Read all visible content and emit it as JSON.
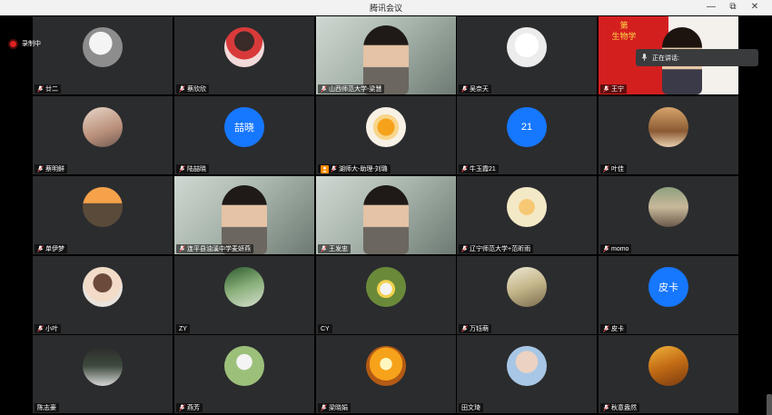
{
  "window": {
    "title": "腾讯会议",
    "minimize_glyph": "—",
    "maximize_glyph": "⧉",
    "close_glyph": "✕"
  },
  "recording": {
    "label": "录制中",
    "color": "#e02020"
  },
  "speaking": {
    "label": "正在讲话:"
  },
  "accent": "#1677ff",
  "tiles": [
    {
      "name": "廿二",
      "avatar": "photo"
    },
    {
      "name": "蔡欣欣",
      "avatar": "photo"
    },
    {
      "name": "山西师范大学-梁慧",
      "avatar": "video"
    },
    {
      "name": "吴奈天",
      "avatar": "photo"
    },
    {
      "name": "王宁",
      "avatar": "video-red",
      "banner_text": "第\n生物学"
    },
    {
      "name": "蔡明鲜",
      "avatar": "photo"
    },
    {
      "name": "陆喆晓",
      "avatar": "text",
      "avatar_text": "喆晓"
    },
    {
      "name": "湖师大-助理-刘璐",
      "avatar": "photo",
      "assistant": true
    },
    {
      "name": "牛玉霞21",
      "avatar": "text",
      "avatar_text": "21"
    },
    {
      "name": "叶佳",
      "avatar": "photo"
    },
    {
      "name": "单伊梦",
      "avatar": "photo"
    },
    {
      "name": "连平县油溪中学麦妍燕",
      "avatar": "video"
    },
    {
      "name": "王发忠",
      "avatar": "video"
    },
    {
      "name": "辽宁师范大学+范昕雨",
      "avatar": "photo"
    },
    {
      "name": "momo",
      "avatar": "photo"
    },
    {
      "name": "小叶",
      "avatar": "photo"
    },
    {
      "name": "ZY",
      "avatar": "photo",
      "no_mic": true
    },
    {
      "name": "CY",
      "avatar": "photo",
      "no_mic": true
    },
    {
      "name": "万钰萌",
      "avatar": "photo"
    },
    {
      "name": "皮卡",
      "avatar": "text",
      "avatar_text": "皮卡"
    },
    {
      "name": "陈志豪",
      "avatar": "photo",
      "no_mic": true
    },
    {
      "name": "燕芳",
      "avatar": "photo"
    },
    {
      "name": "梁晓娟",
      "avatar": "photo"
    },
    {
      "name": "田文琦",
      "avatar": "photo",
      "no_mic": true
    },
    {
      "name": "秋意盎然",
      "avatar": "photo"
    }
  ]
}
